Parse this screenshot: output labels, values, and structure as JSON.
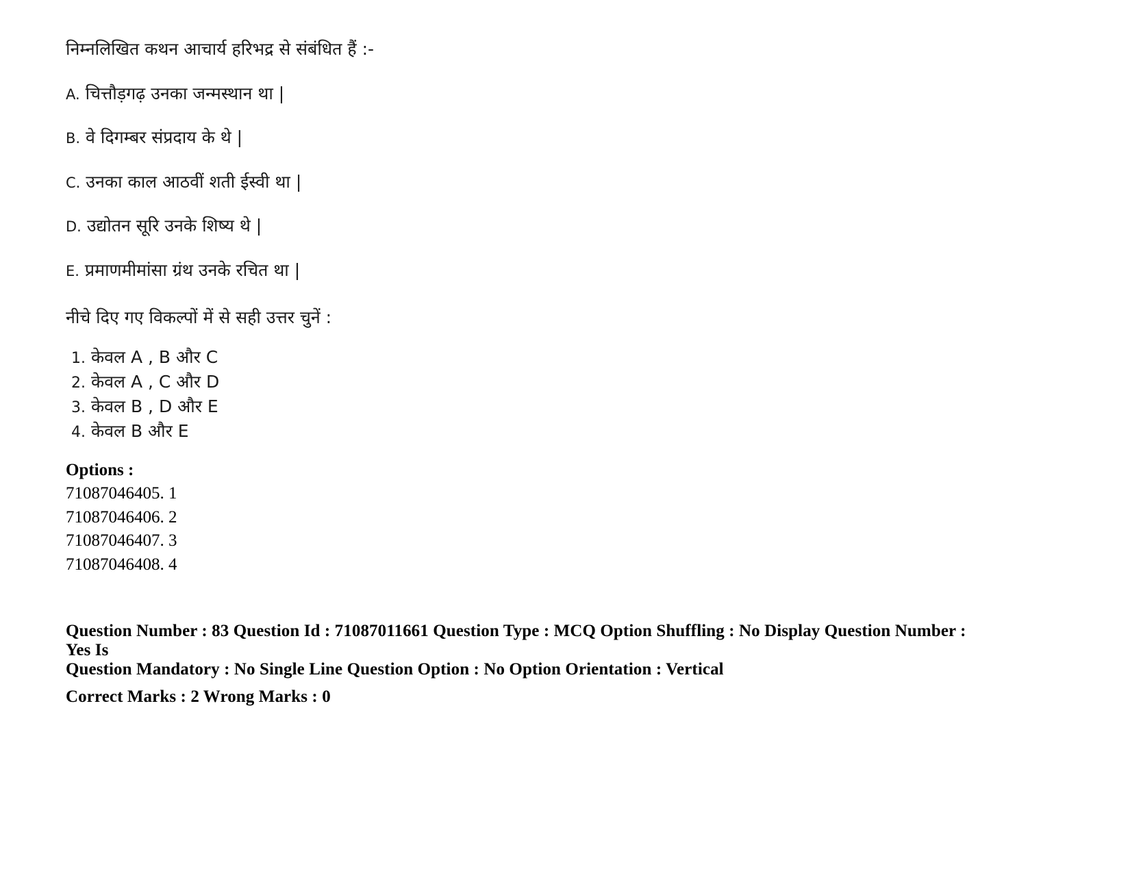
{
  "question": {
    "stem": "निम्नलिखित कथन आचार्य हरिभद्र से संबंधित हैं :-",
    "statements": [
      {
        "label": "A.",
        "text": "चित्तौड़गढ़ उनका जन्मस्थान था |"
      },
      {
        "label": "B.",
        "text": "वे दिगम्बर संप्रदाय के थे |"
      },
      {
        "label": "C.",
        "text": "उनका काल आठवीं शती ईस्वी था |"
      },
      {
        "label": "D.",
        "text": "उद्योतन सूरि उनके शिष्य थे |"
      },
      {
        "label": "E.",
        "text": "प्रमाणमीमांसा ग्रंथ उनके रचित था |"
      }
    ],
    "choose_instruction": "नीचे दिए गए विकल्पों में से सही उत्तर चुनें :",
    "choices": [
      {
        "number": "1.",
        "text": "केवल A , B और C"
      },
      {
        "number": "2.",
        "text": "केवल A , C और D"
      },
      {
        "number": "3.",
        "text": "केवल B , D और E"
      },
      {
        "number": "4.",
        "text": "केवल B और E"
      }
    ]
  },
  "options_section": {
    "heading": "Options :",
    "items": [
      {
        "id": "71087046405.",
        "value": "1"
      },
      {
        "id": "71087046406.",
        "value": "2"
      },
      {
        "id": "71087046407.",
        "value": "3"
      },
      {
        "id": "71087046408.",
        "value": "4"
      }
    ]
  },
  "metadata": {
    "line1": "Question Number : 83 Question Id : 71087011661 Question Type : MCQ Option Shuffling : No Display Question Number : Yes Is",
    "line2": "Question Mandatory : No Single Line Question Option : No Option Orientation : Vertical",
    "line3": "Correct Marks : 2 Wrong Marks : 0"
  }
}
